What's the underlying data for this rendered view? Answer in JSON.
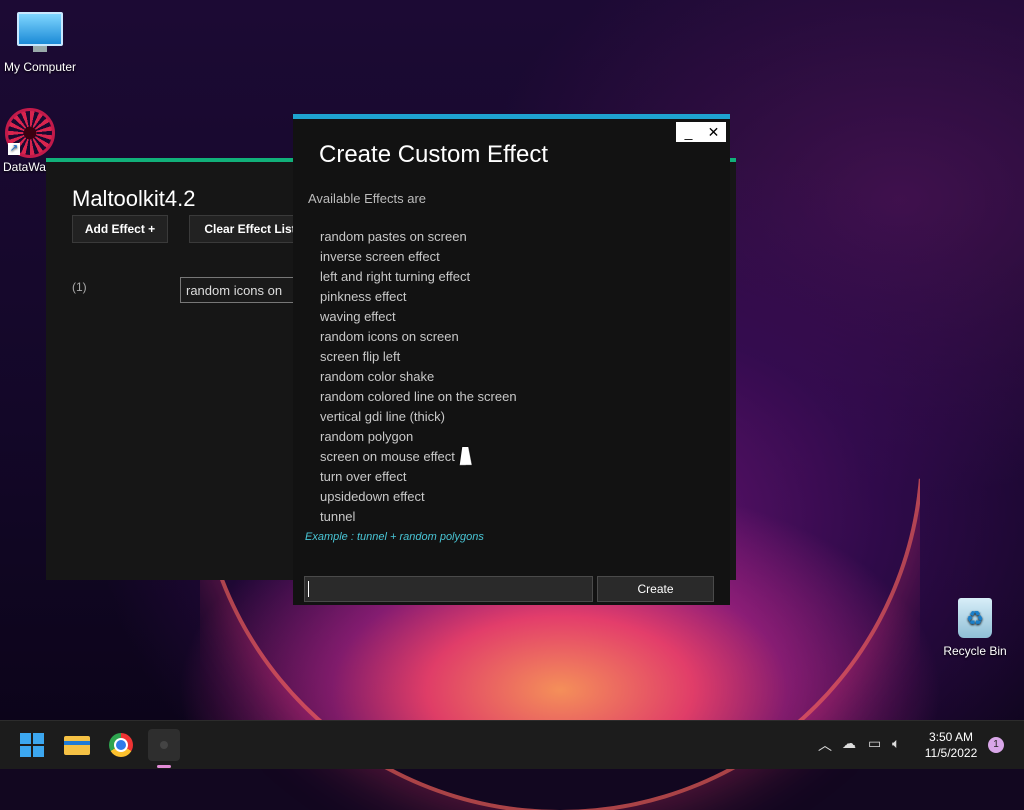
{
  "desktop": {
    "icons": [
      {
        "label": "My Computer"
      },
      {
        "label": "DataWa"
      },
      {
        "label": "Recycle Bin"
      }
    ]
  },
  "back_window": {
    "title": "Maltoolkit4.2",
    "add_effect_label": "Add Effect +",
    "clear_list_label": "Clear Effect List",
    "row_index": "(1)",
    "row_value": "random icons on"
  },
  "dialog": {
    "title": "Create Custom Effect",
    "subtitle": "Available Effects are",
    "effects": [
      "random pastes on screen",
      "inverse screen effect",
      "left and right turning effect",
      "pinkness effect",
      "waving effect",
      "random icons on screen",
      "screen flip left",
      "random color shake",
      "random colored line on the screen",
      "vertical gdi line (thick)",
      "random polygon",
      "screen on mouse effect",
      "turn over effect",
      "upsidedown effect",
      "tunnel"
    ],
    "example": "Example : tunnel + random polygons",
    "input_value": "",
    "create_label": "Create",
    "minimize_glyph": "_",
    "close_glyph": "✕"
  },
  "taskbar": {
    "time": "3:50 AM",
    "date": "11/5/2022",
    "notification_count": "1",
    "tray_icons": [
      "chevron-up-icon",
      "cloud-off-icon",
      "network-icon",
      "volume-icon"
    ]
  },
  "colors": {
    "dialog_accent": "#1ea3d0",
    "back_window_accent": "#11b07a",
    "example_text": "#49c6d6"
  }
}
